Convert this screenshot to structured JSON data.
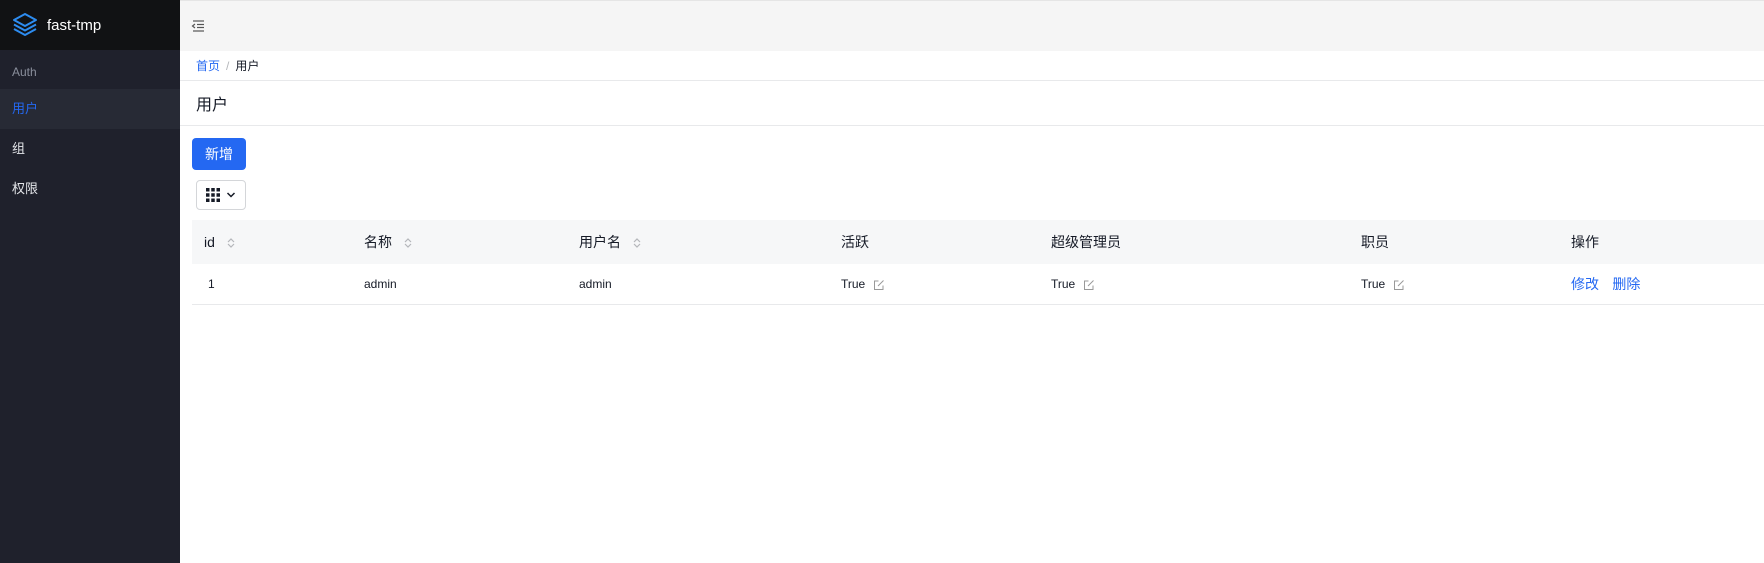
{
  "app": {
    "title": "fast-tmp"
  },
  "sidebar": {
    "group_label": "Auth",
    "items": [
      {
        "label": "用户",
        "active": true
      },
      {
        "label": "组",
        "active": false
      },
      {
        "label": "权限",
        "active": false
      }
    ]
  },
  "breadcrumb": {
    "home": "首页",
    "separator": "/",
    "current": "用户"
  },
  "page": {
    "title": "用户"
  },
  "toolbar": {
    "add_label": "新增"
  },
  "table": {
    "columns": [
      "id",
      "名称",
      "用户名",
      "活跃",
      "超级管理员",
      "职员",
      "操作"
    ],
    "rows": [
      {
        "id": "1",
        "name": "admin",
        "username": "admin",
        "is_active": "True",
        "is_superuser": "True",
        "is_staff": "True",
        "edit_label": "修改",
        "delete_label": "删除"
      }
    ]
  },
  "colors": {
    "accent": "#2468f2",
    "sidebar_bg": "#1f212c",
    "brand_bg": "#111214",
    "topbar_bg": "#f5f5f5"
  }
}
